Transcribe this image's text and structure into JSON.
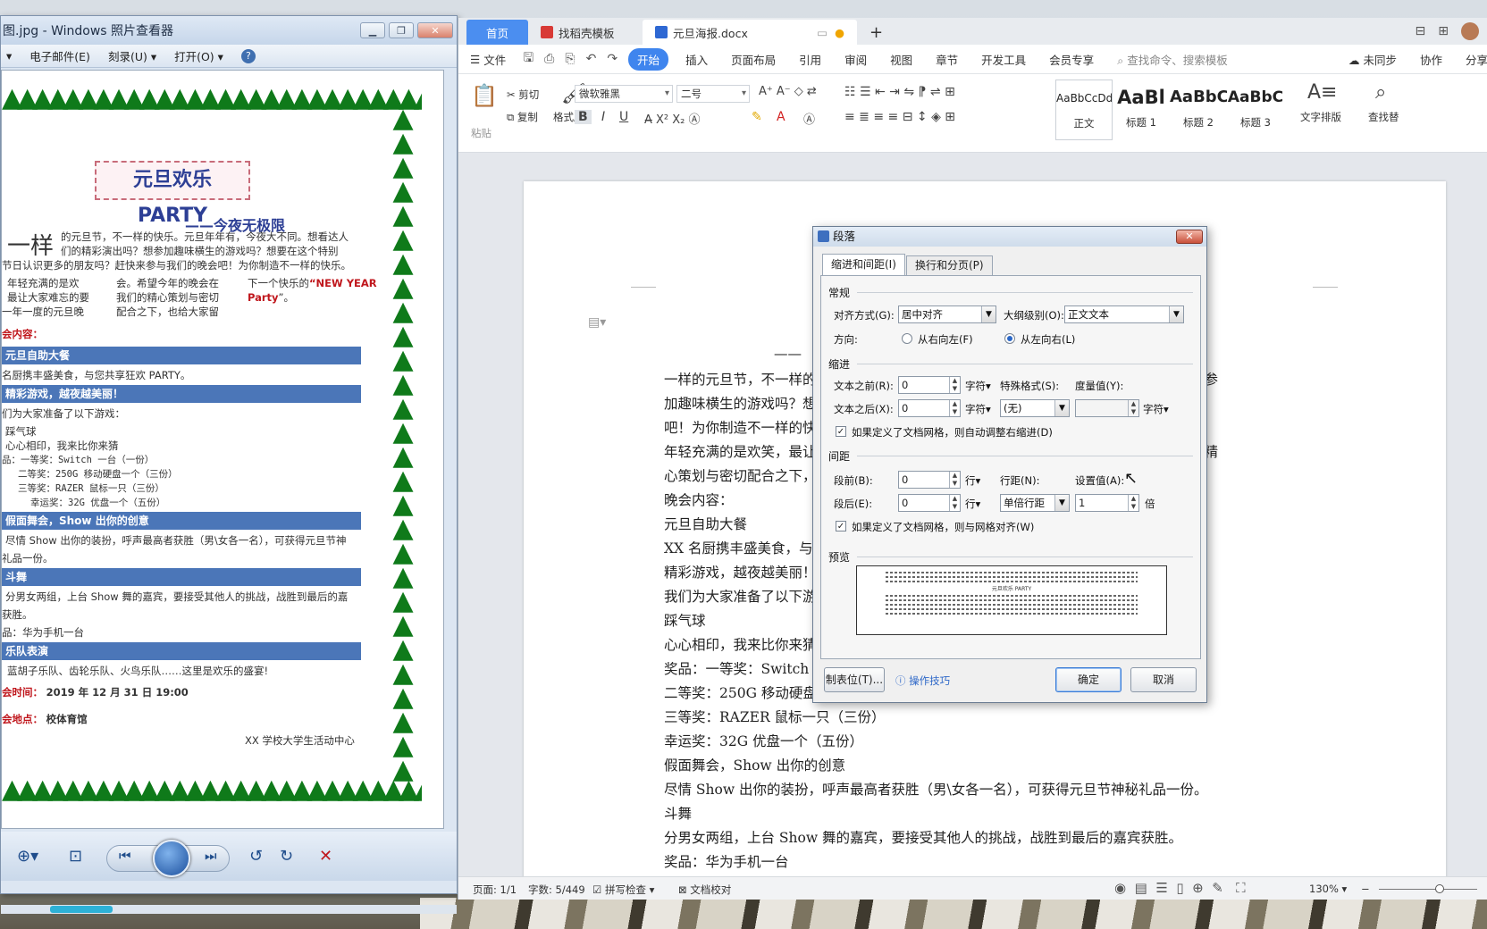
{
  "photo_viewer": {
    "title": "图.jpg - Windows 照片查看器",
    "menu": [
      "▾",
      "电子邮件(E)",
      "刻录(U) ▾",
      "打开(O) ▾"
    ],
    "poster": {
      "title": "元旦欢乐 PARTY",
      "subtitle": "——今夜无极限",
      "big_char": "一样",
      "intro_lines": [
        "的元旦节，不一样的快乐。元旦年年有，今夜大不同。想看达人",
        "们的精彩演出吗？想参加趣味横生的游戏吗？想要在这个特别",
        "节日认识更多的朋友吗？赶快来参与我们的晚会吧！为你制造不一样的快乐。"
      ],
      "col1": [
        "年轻充满的是欢",
        "最让大家难忘的要",
        "一年一度的元旦晚"
      ],
      "col2": [
        "会。希望今年的晚会在",
        "我们的精心策划与密切",
        "配合之下，也给大家留"
      ],
      "col3_prefix": "下一个快乐的",
      "col3_red": "“NEW YEAR",
      "col3_red2": "Party",
      "col3_suffix": "”。",
      "content_label": "会内容：",
      "bar1": "元旦自助大餐",
      "line1": "名厨携丰盛美食，与您共享狂欢 PARTY。",
      "bar2": "精彩游戏，越夜越美丽！",
      "line2": "们为大家准备了以下游戏：",
      "game1": "踩气球",
      "game2": "心心相印，我来比你来猜",
      "prize1": "品：一等奖：Switch 一台（一份）",
      "prize2": "二等奖：250G 移动硬盘一个（三份）",
      "prize3": "三等奖：RAZER 鼠标一只（三份）",
      "prize4": "幸运奖：32G 优盘一个（五份）",
      "bar3": "假面舞会，Show 出你的创意",
      "line3a": "尽情 Show 出你的装扮，呼声最高者获胜（男\\女各一名），可获得元旦节神",
      "line3b": "礼品一份。",
      "bar4": "斗舞",
      "line4a": "分男女两组，上台 Show 舞的嘉宾，要接受其他人的挑战，战胜到最后的嘉",
      "line4b": "获胜。",
      "line4c": "品：华为手机一台",
      "bar5": "乐队表演",
      "line5": "蓝胡子乐队、齿轮乐队、火鸟乐队……这里是欢乐的盛宴!",
      "time_label": "会时间：",
      "time_value": "2019 年 12 月 31 日 19:00",
      "place_label": "会地点：",
      "place_value": "校体育馆",
      "signature": "XX 学校大学生活动中心"
    }
  },
  "wps": {
    "tabs": {
      "home": "首页",
      "template": "找稻壳模板",
      "doc": "元旦海报.docx"
    },
    "menu": {
      "file": "文件",
      "start": "开始",
      "insert": "插入",
      "layout": "页面布局",
      "ref": "引用",
      "review": "审阅",
      "view": "视图",
      "chapter": "章节",
      "dev": "开发工具",
      "member": "会员专享",
      "search": "查找命令、搜索模板",
      "sync": "未同步",
      "collab": "协作",
      "share": "分享"
    },
    "ribbon": {
      "paste": "粘贴",
      "cut": "剪切",
      "copy": "复制",
      "format_painter": "格式刷",
      "font": "微软雅黑",
      "size": "二号",
      "styles": [
        {
          "sample": "AaBbCcDd",
          "name": "正文"
        },
        {
          "sample": "AaBl",
          "name": "标题 1"
        },
        {
          "sample": "AaBbC",
          "name": "标题 2"
        },
        {
          "sample": "AaBbC",
          "name": "标题 3"
        }
      ],
      "text_layout": "文字排版",
      "find_replace": "查找替"
    },
    "doc_lines": [
      "——",
      "一样的元旦节，不一样的快乐。元旦年年有，今夜大不同。想看达人们的精彩演出吗？想参",
      "加趣味横生的游戏吗？想要在这个特别节日认识更多的朋友吗？赶快来参与我们的晚会",
      "吧！为你制造不一样的快乐。",
      "年轻充满的是欢笑，最让大家难忘的要数一年一度的元旦晚会。希望今年的晚会在我们的精",
      "心策划与密切配合之下，也给大家留下一个快乐的“NEW YEAR Party”。",
      "晚会内容：",
      "元旦自助大餐",
      "XX 名厨携丰盛美食，与您共享狂欢 PARTY。",
      "精彩游戏，越夜越美丽！",
      "我们为大家准备了以下游戏：",
      "踩气球",
      "心心相印，我来比你来猜",
      "奖品：一等奖：Switch 一台（一份）",
      "二等奖：250G 移动硬盘一个（三份）",
      "三等奖：RAZER 鼠标一只（三份）",
      "幸运奖：32G 优盘一个（五份）",
      "假面舞会，Show 出你的创意",
      "尽情 Show 出你的装扮，呼声最高者获胜（男\\女各一名），可获得元旦节神秘礼品一份。",
      "斗舞",
      "分男女两组，上台 Show 舞的嘉宾，要接受其他人的挑战，战胜到最后的嘉宾获胜。",
      "奖品：华为手机一台"
    ],
    "status": {
      "page": "页面: 1/1",
      "words": "字数: 5/449",
      "spell": "拼写检查 ▾",
      "proof": "文档校对",
      "zoom": "130% ▾"
    }
  },
  "dialog": {
    "title": "段落",
    "tab_indent": "缩进和间距(I)",
    "tab_break": "换行和分页(P)",
    "sec_general": "常规",
    "align_label": "对齐方式(G):",
    "align_value": "居中对齐",
    "outline_label": "大纲级别(O):",
    "outline_value": "正文文本",
    "direction_label": "方向:",
    "rtl_label": "从右向左(F)",
    "ltr_label": "从左向右(L)",
    "sec_indent": "缩进",
    "before_text_label": "文本之前(R):",
    "before_text_value": "0",
    "after_text_label": "文本之后(X):",
    "after_text_value": "0",
    "unit_char": "字符▾",
    "special_label": "特殊格式(S):",
    "special_value": "(无)",
    "measure_label": "度量值(Y):",
    "auto_indent_label": "如果定义了文档网格，则自动调整右缩进(D)",
    "sec_spacing": "间距",
    "before_label": "段前(B):",
    "before_value": "0",
    "after_label": "段后(E):",
    "after_value": "0",
    "unit_line": "行▾",
    "line_spacing_label": "行距(N):",
    "line_spacing_value": "单倍行距",
    "setting_label": "设置值(A):",
    "setting_value": "1",
    "unit_times": "倍",
    "grid_align_label": "如果定义了文档网格，则与网格对齐(W)",
    "sec_preview": "预览",
    "preview_title": "元旦欢乐 PARTY",
    "tabs_button": "制表位(T)...",
    "tips_label": "操作技巧",
    "ok": "确定",
    "cancel": "取消"
  },
  "colors": {
    "accent": "#3f85ee",
    "poster_blue": "#4b76b8",
    "poster_red": "#c0171d",
    "tree_green": "#0f7a1a"
  }
}
